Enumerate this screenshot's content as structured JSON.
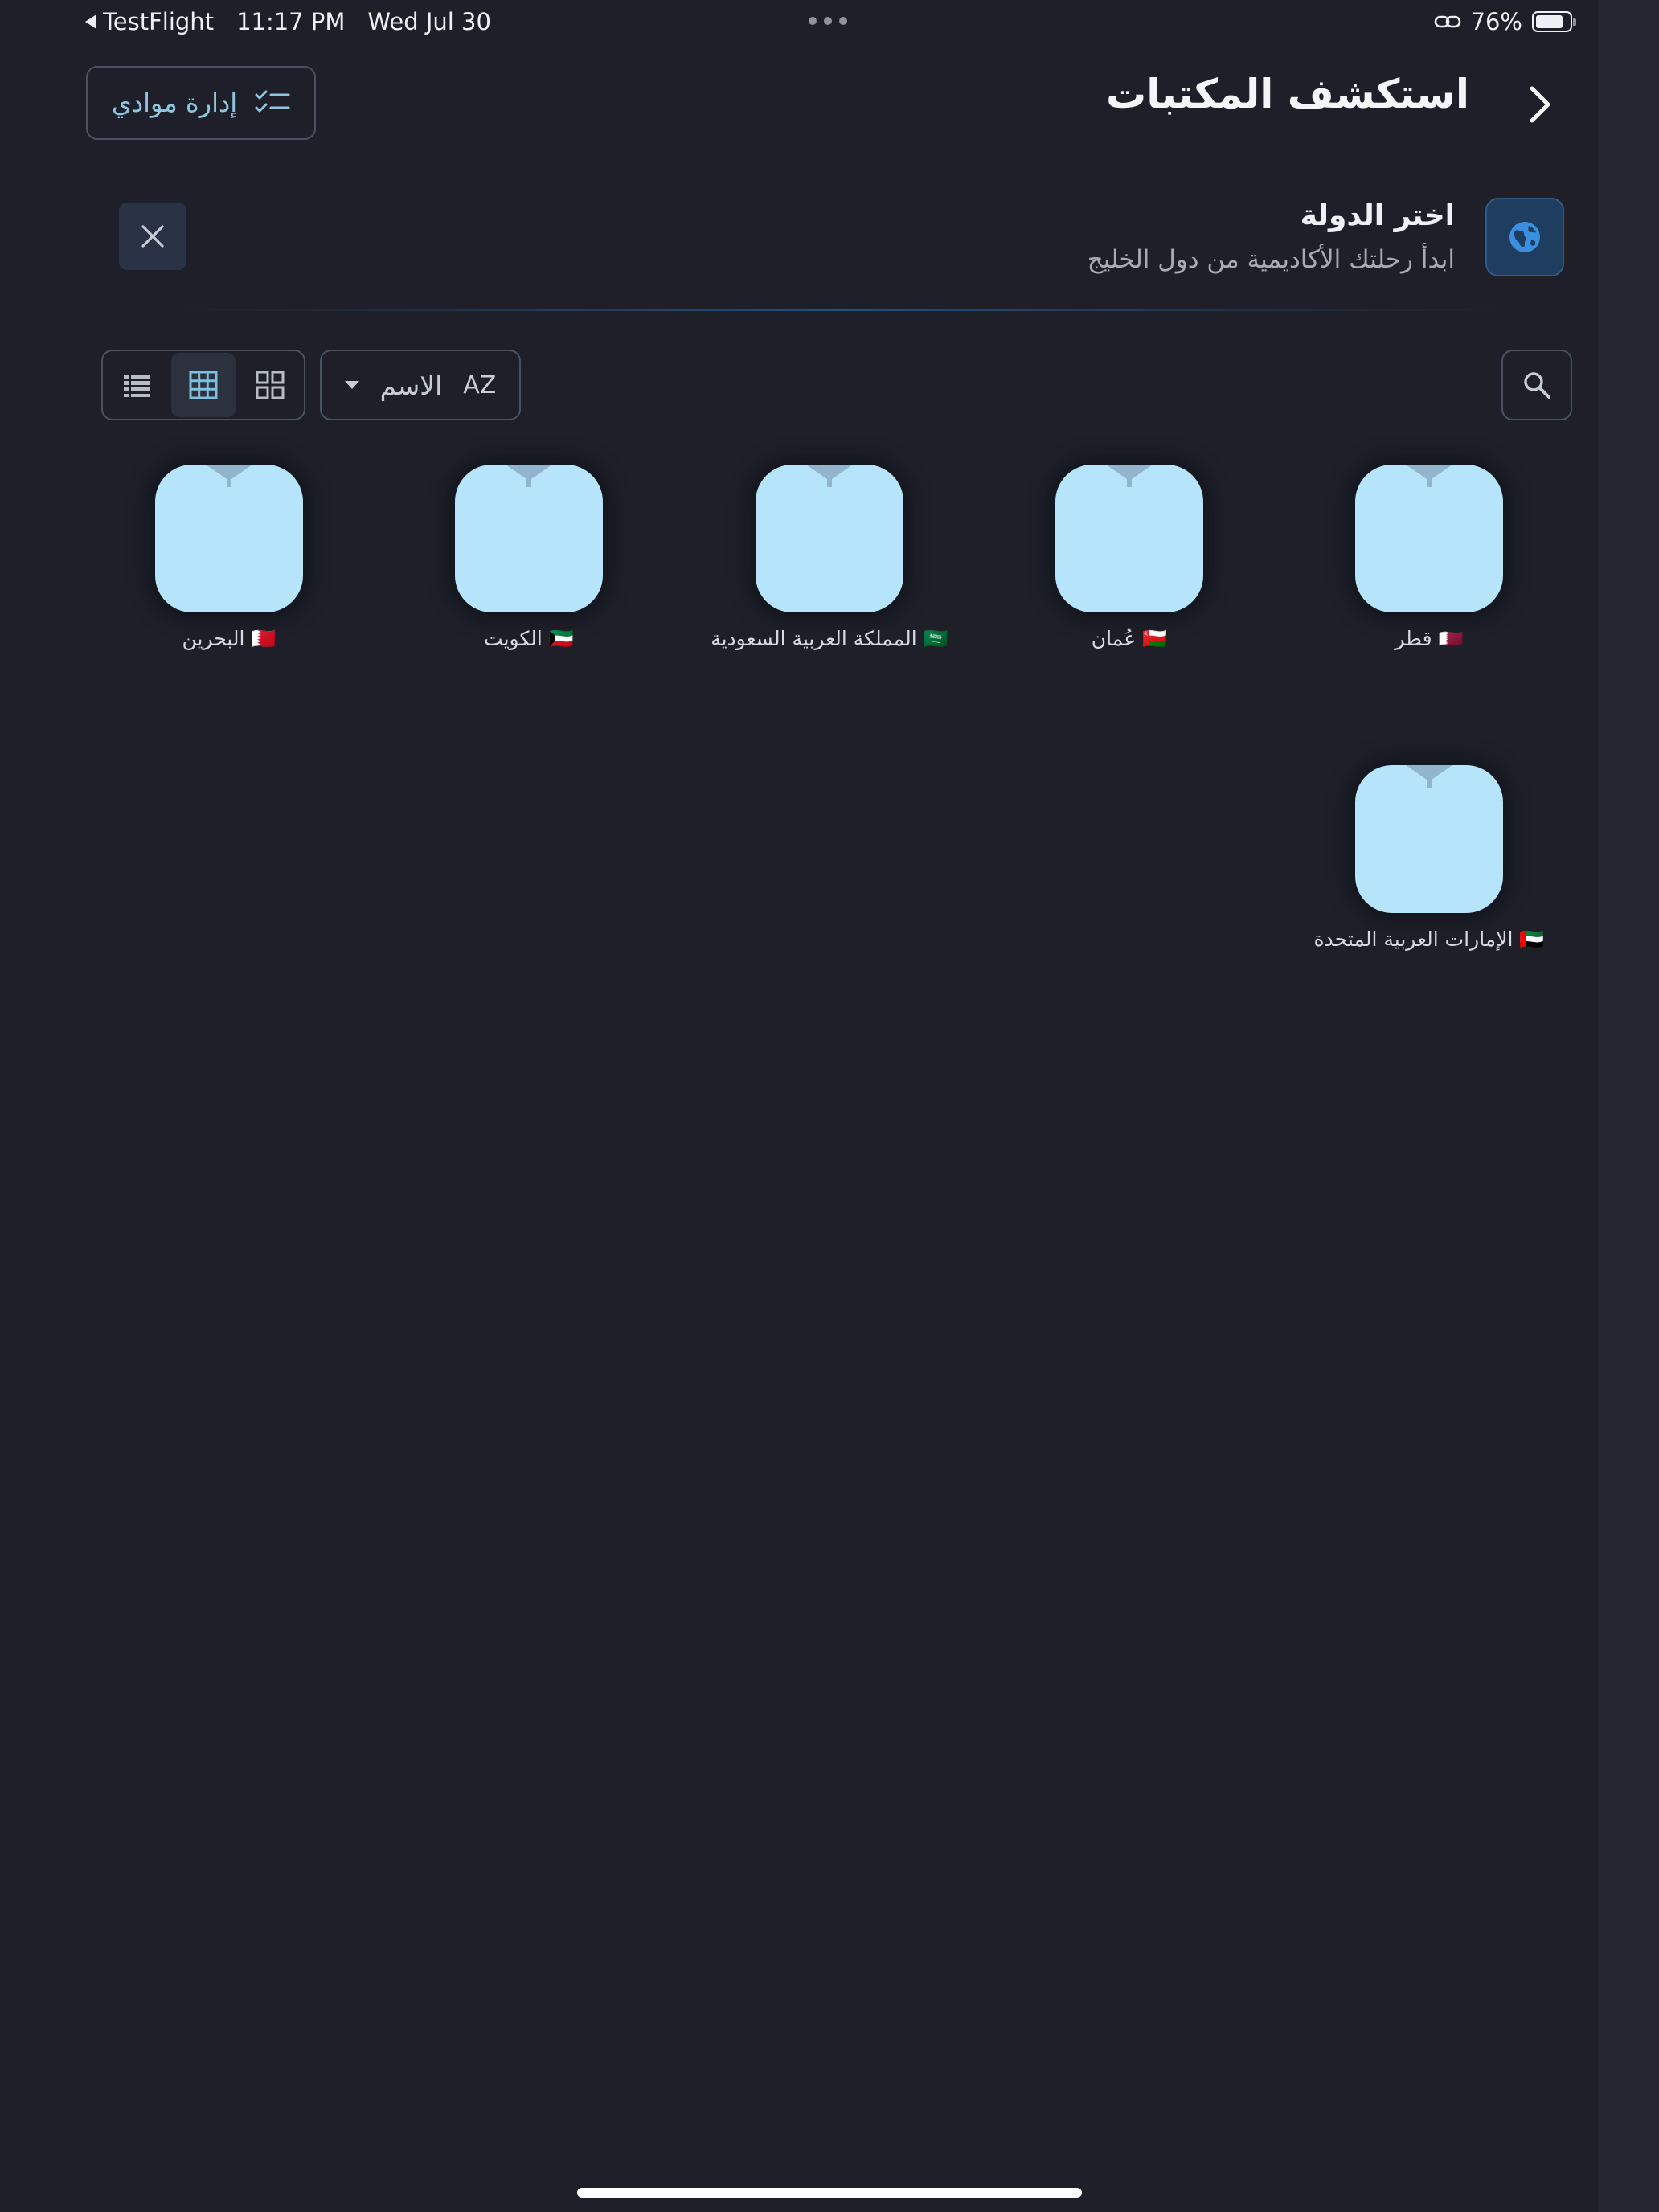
{
  "status_bar": {
    "back_app": "TestFlight",
    "time": "11:17 PM",
    "date": "Wed Jul 30",
    "battery_percent": "76%",
    "battery_level": 0.76
  },
  "header": {
    "title": "استكشف المكتبات",
    "manage_button_label": "إدارة موادي",
    "back_icon": "chevron-right-icon",
    "manage_icon": "checklist-icon"
  },
  "banner": {
    "title": "اختر الدولة",
    "subtitle": "ابدأ رحلتك الأكاديمية من دول الخليج",
    "icon": "globe-icon",
    "close_icon": "close-icon"
  },
  "toolbar": {
    "sort_label": "الاسم",
    "sort_icon_text": "AZ",
    "view_modes": [
      "list",
      "table",
      "grid"
    ],
    "active_view": "table"
  },
  "countries": [
    {
      "flag": "🇶🇦",
      "name": "قطر"
    },
    {
      "flag": "🇴🇲",
      "name": "عُمان"
    },
    {
      "flag": "🇸🇦",
      "name": "المملكة العربية السعودية"
    },
    {
      "flag": "🇰🇼",
      "name": "الكويت"
    },
    {
      "flag": "🇧🇭",
      "name": "البحرين"
    },
    {
      "flag": "🇦🇪",
      "name": "الإمارات العربية المتحدة"
    }
  ],
  "colors": {
    "background": "#1e1f29",
    "tile": "#b6e5fb",
    "accent": "#8ec5df",
    "globe_button": "#1f3d5f",
    "border": "#4a5262"
  }
}
